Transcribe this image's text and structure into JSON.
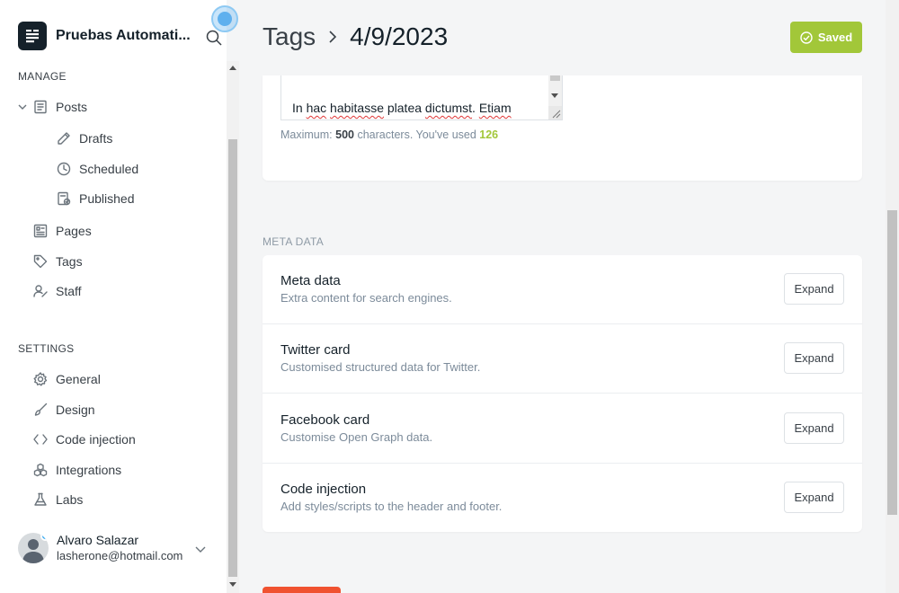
{
  "sidebar": {
    "brand_title": "Pruebas Automati...",
    "manage_heading": "MANAGE",
    "settings_heading": "SETTINGS",
    "items": {
      "posts": "Posts",
      "drafts": "Drafts",
      "scheduled": "Scheduled",
      "published": "Published",
      "pages": "Pages",
      "tags": "Tags",
      "staff": "Staff",
      "general": "General",
      "design": "Design",
      "code_injection": "Code injection",
      "integrations": "Integrations",
      "labs": "Labs"
    },
    "user": {
      "name": "Alvaro Salazar",
      "email": "lasherone@hotmail.com"
    }
  },
  "header": {
    "breadcrumb_parent": "Tags",
    "breadcrumb_current": "4/9/2023",
    "saved_label": "Saved"
  },
  "description": {
    "text_visible_parts": [
      "In ",
      "hac",
      " ",
      "habitasse",
      " platea ",
      "dictumst",
      ". ",
      "Etiam"
    ],
    "count_prefix": "Maximum: ",
    "max": "500",
    "count_middle": " characters. You've used ",
    "used": "126"
  },
  "meta": {
    "section_label": "META DATA",
    "rows": [
      {
        "title": "Meta data",
        "desc": "Extra content for search engines.",
        "button": "Expand"
      },
      {
        "title": "Twitter card",
        "desc": "Customised structured data for Twitter.",
        "button": "Expand"
      },
      {
        "title": "Facebook card",
        "desc": "Customise Open Graph data.",
        "button": "Expand"
      },
      {
        "title": "Code injection",
        "desc": "Add styles/scripts to the header and footer.",
        "button": "Expand"
      }
    ]
  },
  "colors": {
    "accent_green": "#a2c739",
    "danger_red": "#f05230",
    "dark": "#15212a"
  }
}
